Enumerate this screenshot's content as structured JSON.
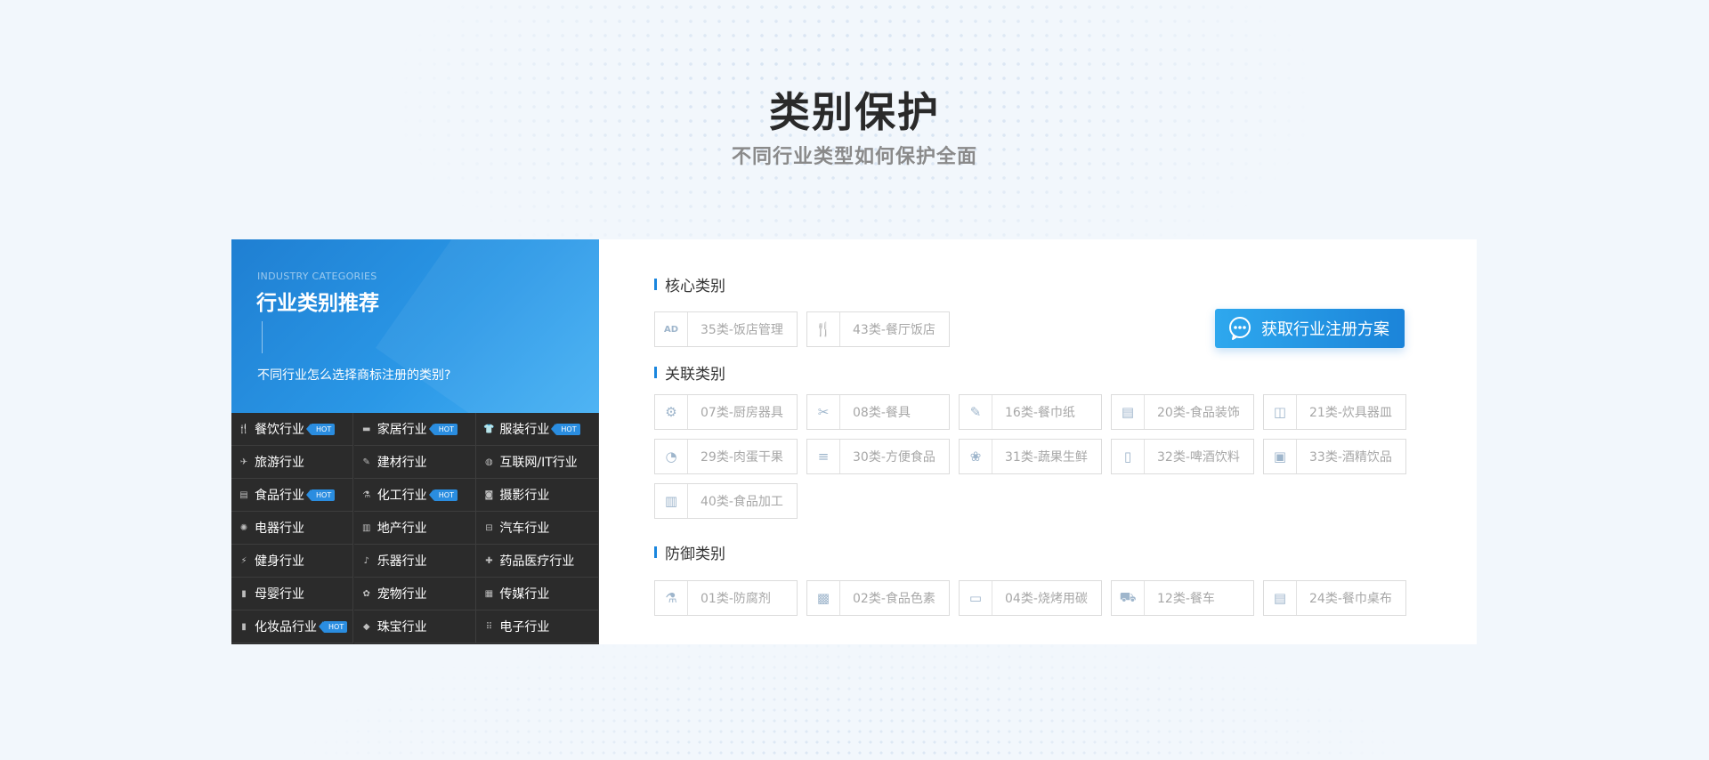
{
  "heading": {
    "title": "类别保护",
    "subtitle": "不同行业类型如何保护全面"
  },
  "left_panel": {
    "en": "INDUSTRY CATEGORIES",
    "title": "行业类别推荐",
    "subtitle": "不同行业怎么选择商标注册的类别?",
    "hot_label": "HOT",
    "industries": [
      {
        "label": "餐饮行业",
        "hot": true,
        "icon": "fork-knife-icon"
      },
      {
        "label": "家居行业",
        "hot": true,
        "icon": "sofa-icon"
      },
      {
        "label": "服装行业",
        "hot": true,
        "icon": "shirt-icon"
      },
      {
        "label": "旅游行业",
        "hot": false,
        "icon": "plane-icon"
      },
      {
        "label": "建材行业",
        "hot": false,
        "icon": "brush-icon"
      },
      {
        "label": "互联网/IT行业",
        "hot": false,
        "icon": "globe-icon"
      },
      {
        "label": "食品行业",
        "hot": true,
        "icon": "food-icon"
      },
      {
        "label": "化工行业",
        "hot": true,
        "icon": "flask-icon"
      },
      {
        "label": "摄影行业",
        "hot": false,
        "icon": "camera-icon"
      },
      {
        "label": "电器行业",
        "hot": false,
        "icon": "fan-icon"
      },
      {
        "label": "地产行业",
        "hot": false,
        "icon": "building-icon"
      },
      {
        "label": "汽车行业",
        "hot": false,
        "icon": "car-icon"
      },
      {
        "label": "健身行业",
        "hot": false,
        "icon": "run-icon"
      },
      {
        "label": "乐器行业",
        "hot": false,
        "icon": "guitar-icon"
      },
      {
        "label": "药品医疗行业",
        "hot": false,
        "icon": "medkit-icon"
      },
      {
        "label": "母婴行业",
        "hot": false,
        "icon": "bottle-icon"
      },
      {
        "label": "宠物行业",
        "hot": false,
        "icon": "paw-icon"
      },
      {
        "label": "传媒行业",
        "hot": false,
        "icon": "media-icon"
      },
      {
        "label": "化妆品行业",
        "hot": true,
        "icon": "lipstick-icon"
      },
      {
        "label": "珠宝行业",
        "hot": false,
        "icon": "diamond-icon"
      },
      {
        "label": "电子行业",
        "hot": false,
        "icon": "chip-icon"
      }
    ]
  },
  "sections": {
    "core": {
      "title": "核心类别",
      "items": [
        {
          "label": "35类-饭店管理",
          "icon": "ad-icon"
        },
        {
          "label": "43类-餐厅饭店",
          "icon": "utensils-icon"
        }
      ]
    },
    "related": {
      "title": "关联类别",
      "items": [
        {
          "label": "07类-厨房器具",
          "icon": "gear-icon"
        },
        {
          "label": "08类-餐具",
          "icon": "scissors-icon"
        },
        {
          "label": "16类-餐巾纸",
          "icon": "pencil-icon"
        },
        {
          "label": "20类-食品装饰",
          "icon": "cabinet-icon"
        },
        {
          "label": "21类-炊具器皿",
          "icon": "cup-icon"
        },
        {
          "label": "29类-肉蛋干果",
          "icon": "meat-icon"
        },
        {
          "label": "30类-方便食品",
          "icon": "burger-icon"
        },
        {
          "label": "31类-蔬果生鲜",
          "icon": "leaf-icon"
        },
        {
          "label": "32类-啤酒饮料",
          "icon": "beer-icon"
        },
        {
          "label": "33类-酒精饮品",
          "icon": "wine-icon"
        },
        {
          "label": "40类-食品加工",
          "icon": "machine-icon"
        }
      ]
    },
    "defense": {
      "title": "防御类别",
      "items": [
        {
          "label": "01类-防腐剂",
          "icon": "flask-icon"
        },
        {
          "label": "02类-食品色素",
          "icon": "paint-icon"
        },
        {
          "label": "04类-烧烤用碳",
          "icon": "fuel-icon"
        },
        {
          "label": "12类-餐车",
          "icon": "truck-icon"
        },
        {
          "label": "24类-餐巾桌布",
          "icon": "napkin-icon"
        }
      ]
    }
  },
  "cta": {
    "label": "获取行业注册方案",
    "icon": "chat-icon"
  },
  "colors": {
    "accent": "#1a86de",
    "panel_dark": "#2b2b2b",
    "hot_badge": "#2a8de0"
  }
}
